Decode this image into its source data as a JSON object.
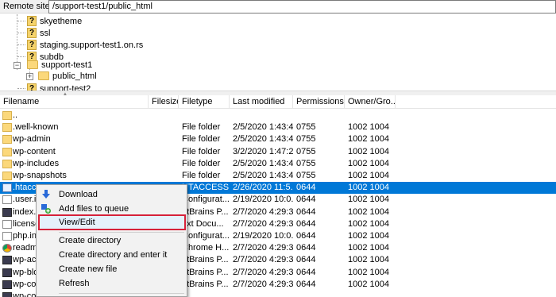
{
  "remote": {
    "label": "Remote site:",
    "path": "/support-test1/public_html"
  },
  "tree": {
    "items": [
      {
        "label": "skyetheme",
        "icon": "question-folder-icon"
      },
      {
        "label": "ssl",
        "icon": "question-folder-icon"
      },
      {
        "label": "staging.support-test1.on.rs",
        "icon": "question-folder-icon"
      },
      {
        "label": "subdb",
        "icon": "question-folder-icon"
      },
      {
        "label": "support-test1",
        "icon": "folder-icon"
      },
      {
        "label": "public_html",
        "icon": "folder-icon"
      },
      {
        "label": "support-test2",
        "icon": "question-folder-icon"
      }
    ]
  },
  "list": {
    "columns": [
      "Filename",
      "Filesize",
      "Filetype",
      "Last modified",
      "Permissions",
      "Owner/Gro..."
    ],
    "rows": [
      {
        "name": "..",
        "size": "",
        "type": "",
        "modified": "",
        "perms": "",
        "owner": "",
        "icon": "folder"
      },
      {
        "name": ".well-known",
        "size": "",
        "type": "File folder",
        "modified": "2/5/2020 1:43:4...",
        "perms": "0755",
        "owner": "1002 1004",
        "icon": "folder"
      },
      {
        "name": "wp-admin",
        "size": "",
        "type": "File folder",
        "modified": "2/5/2020 1:43:4...",
        "perms": "0755",
        "owner": "1002 1004",
        "icon": "folder"
      },
      {
        "name": "wp-content",
        "size": "",
        "type": "File folder",
        "modified": "3/2/2020 1:47:2...",
        "perms": "0755",
        "owner": "1002 1004",
        "icon": "folder"
      },
      {
        "name": "wp-includes",
        "size": "",
        "type": "File folder",
        "modified": "2/5/2020 1:43:4...",
        "perms": "0755",
        "owner": "1002 1004",
        "icon": "folder"
      },
      {
        "name": "wp-snapshots",
        "size": "",
        "type": "File folder",
        "modified": "2/5/2020 1:43:4...",
        "perms": "0755",
        "owner": "1002 1004",
        "icon": "folder"
      },
      {
        "name": ".htacce",
        "size": "",
        "type": "HTACCESS ...",
        "modified": "2/26/2020 11:5...",
        "perms": "0644",
        "owner": "1002 1004",
        "icon": "dotfile",
        "selected": true
      },
      {
        "name": ".user.in",
        "size": "",
        "type": "Configurat...",
        "modified": "2/19/2020 10:0...",
        "perms": "0644",
        "owner": "1002 1004",
        "icon": "file"
      },
      {
        "name": "index.p",
        "size": "",
        "type": "etBrains P...",
        "modified": "2/7/2020 4:29:3...",
        "perms": "0644",
        "owner": "1002 1004",
        "icon": "php"
      },
      {
        "name": "license",
        "size": "",
        "type": "ext Docu...",
        "modified": "2/7/2020 4:29:3...",
        "perms": "0644",
        "owner": "1002 1004",
        "icon": "file"
      },
      {
        "name": "php.ini",
        "size": "",
        "type": "Configurat...",
        "modified": "2/19/2020 10:0...",
        "perms": "0644",
        "owner": "1002 1004",
        "icon": "file"
      },
      {
        "name": "readm",
        "size": "",
        "type": "Chrome H...",
        "modified": "2/7/2020 4:29:3...",
        "perms": "0644",
        "owner": "1002 1004",
        "icon": "chrome"
      },
      {
        "name": "wp-act",
        "size": "",
        "type": "etBrains P...",
        "modified": "2/7/2020 4:29:3...",
        "perms": "0644",
        "owner": "1002 1004",
        "icon": "php"
      },
      {
        "name": "wp-blo",
        "size": "",
        "type": "etBrains P...",
        "modified": "2/7/2020 4:29:3...",
        "perms": "0644",
        "owner": "1002 1004",
        "icon": "php"
      },
      {
        "name": "wp-co",
        "size": "",
        "type": "etBrains P...",
        "modified": "2/7/2020 4:29:3...",
        "perms": "0644",
        "owner": "1002 1004",
        "icon": "php"
      },
      {
        "name": "wp-co",
        "size": "",
        "type": "",
        "modified": "",
        "perms": "",
        "owner": "",
        "icon": "php"
      }
    ]
  },
  "context_menu": {
    "items": [
      {
        "label": "Download",
        "icon": "download-arrow-icon"
      },
      {
        "label": "Add files to queue",
        "icon": "add-to-queue-icon"
      },
      {
        "label": "View/Edit",
        "highlighted": true
      },
      {
        "label": "Create directory"
      },
      {
        "label": "Create directory and enter it"
      },
      {
        "label": "Create new file"
      },
      {
        "label": "Refresh"
      }
    ]
  },
  "colors": {
    "selection": "#0078d7",
    "highlight_border": "#d6213a",
    "folder": "#fbd87b"
  }
}
